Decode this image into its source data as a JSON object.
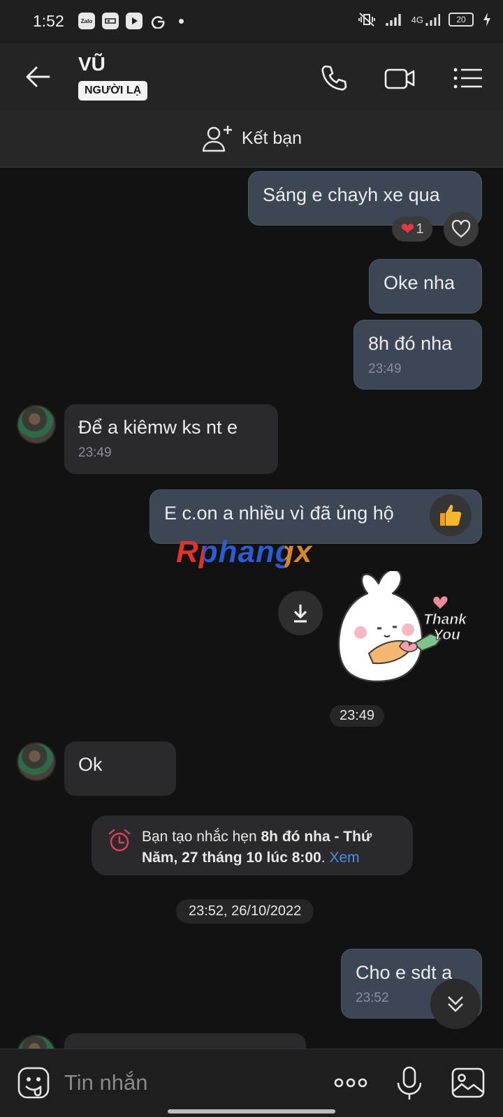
{
  "status": {
    "time": "1:52",
    "notif_labels": [
      "Zalo"
    ],
    "network": "4G",
    "battery": "20"
  },
  "header": {
    "contact_name": "VŨ",
    "badge": "NGƯỜI LẠ"
  },
  "add_friend": {
    "label": "Kết bạn"
  },
  "messages": [
    {
      "text": "Sáng e chayh xe qua",
      "reaction_count": "1"
    },
    {
      "text": "Oke nha"
    },
    {
      "text": "8h đó nha",
      "time": "23:49"
    },
    {
      "text": "Để a kiêmw ks nt e",
      "time": "23:49"
    },
    {
      "text": "E c.on a nhiều vì đã ủng hộ"
    },
    {
      "text": "Ok"
    },
    {
      "text": "Cho e sdt a",
      "time": "23:52"
    }
  ],
  "watermark": "Rphangx",
  "sticker": {
    "caption_line1": "Thank",
    "caption_line2": "You",
    "time": "23:49"
  },
  "reminder": {
    "prefix": "Bạn tạo nhắc hẹn ",
    "title": "8h đó nha - Thứ Năm, 27 tháng 10 lúc 8:00",
    "suffix": ". ",
    "link": "Xem"
  },
  "date_separator": "23:52, 26/10/2022",
  "input": {
    "placeholder": "Tin nhắn"
  }
}
